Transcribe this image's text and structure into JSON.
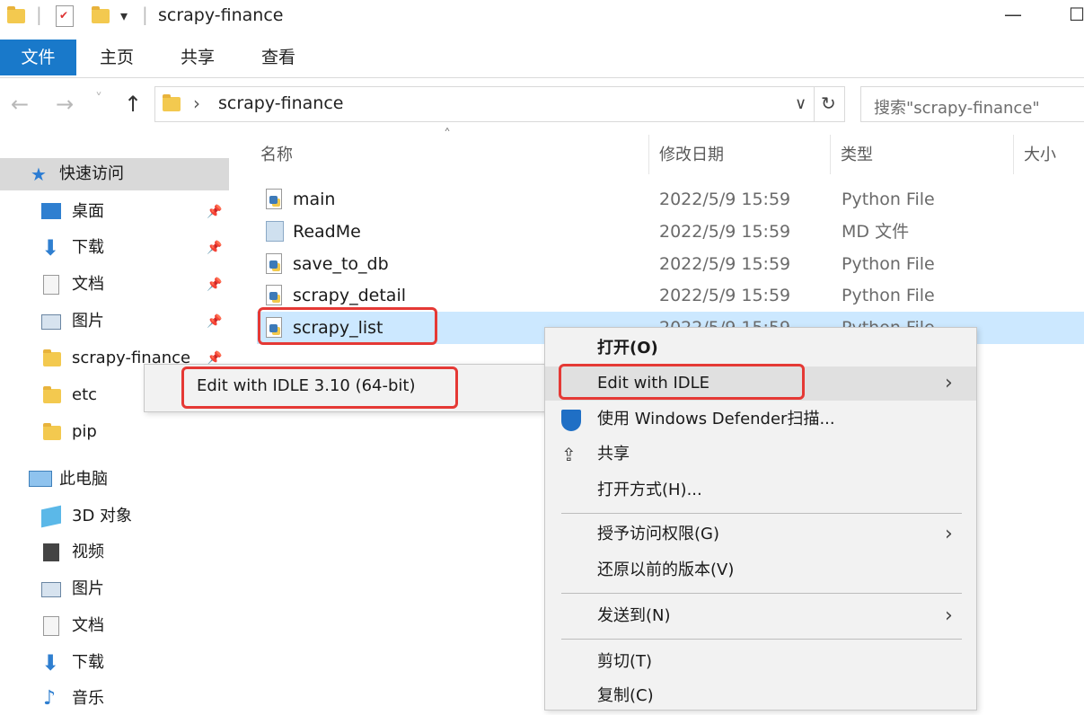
{
  "window": {
    "title": "scrapy-finance",
    "minimize_glyph": "—",
    "maximize_glyph": "☐"
  },
  "qat": {
    "separator": "|",
    "dropdown_glyph": "▾"
  },
  "ribbon": {
    "tabs": [
      "文件",
      "主页",
      "共享",
      "查看"
    ],
    "active": "文件",
    "accent": "#1979ca"
  },
  "nav": {
    "back_glyph": "←",
    "forward_glyph": "→",
    "recent_glyph": "˅",
    "up_glyph": "↑",
    "breadcrumb_sep": "›",
    "path": "scrapy-finance",
    "dropdown_glyph": "∨",
    "refresh_glyph": "↻",
    "search_placeholder": "搜索\"scrapy-finance\""
  },
  "sidebar": {
    "quick_access": "快速访问",
    "items": [
      "桌面",
      "下载",
      "文档",
      "图片",
      "scrapy-finance",
      "etc",
      "pip"
    ],
    "this_pc": "此电脑",
    "pc_items": [
      "3D 对象",
      "视频",
      "图片",
      "文档",
      "下载",
      "音乐"
    ],
    "pin_glyph": "📌",
    "star_glyph": "★"
  },
  "columns": {
    "name": "名称",
    "modified": "修改日期",
    "type": "类型",
    "size": "大小",
    "sort_glyph": "˄"
  },
  "files": [
    {
      "name": "main",
      "date": "2022/5/9 15:59",
      "type": "Python File"
    },
    {
      "name": "ReadMe",
      "date": "2022/5/9 15:59",
      "type": "MD 文件"
    },
    {
      "name": "save_to_db",
      "date": "2022/5/9 15:59",
      "type": "Python File"
    },
    {
      "name": "scrapy_detail",
      "date": "2022/5/9 15:59",
      "type": "Python File"
    },
    {
      "name": "scrapy_list",
      "date": "2022/5/9 15:59",
      "type": "Python File"
    }
  ],
  "context_menu": {
    "open": "打开(O)",
    "edit_idle": "Edit with IDLE",
    "defender": "使用 Windows Defender扫描...",
    "share": "共享",
    "open_with": "打开方式(H)...",
    "grant_access": "授予访问权限(G)",
    "restore": "还原以前的版本(V)",
    "send_to": "发送到(N)",
    "cut": "剪切(T)",
    "copy": "复制(C)",
    "submenu_glyph": "›"
  },
  "submenu": {
    "label": "Edit with IDLE 3.10 (64-bit)"
  },
  "colors": {
    "highlight": "#e53935",
    "selection": "#cce8ff"
  }
}
